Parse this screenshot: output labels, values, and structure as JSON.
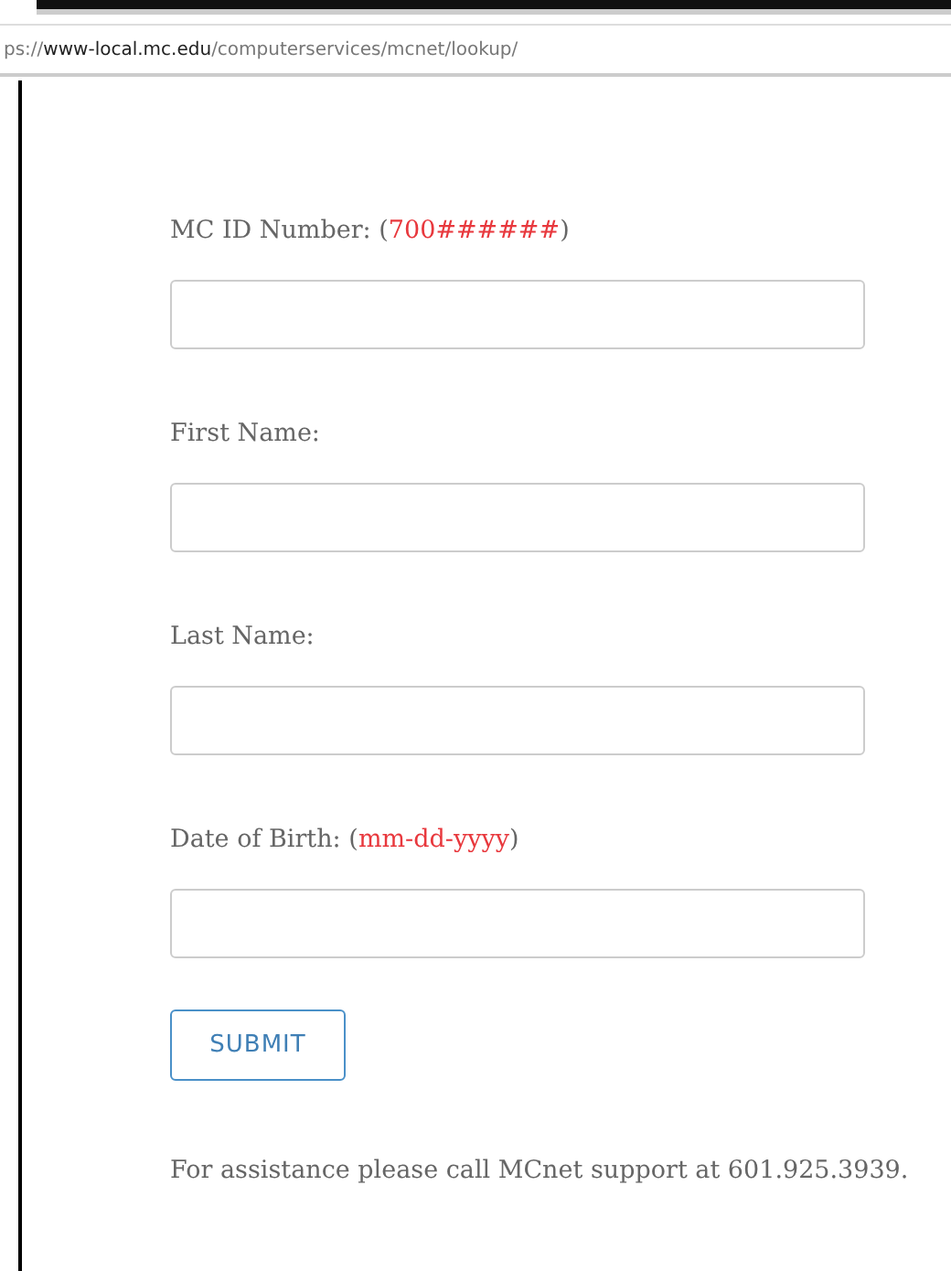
{
  "address_bar": {
    "url_parts": [
      {
        "text": "ps://",
        "kind": "dim"
      },
      {
        "text": "www-local.mc.edu",
        "kind": "host"
      },
      {
        "text": "/computerservices/mcnet/lookup/",
        "kind": "dim"
      }
    ]
  },
  "form": {
    "fields": [
      {
        "label": "MC ID Number:",
        "hint": "(700######)"
      },
      {
        "label": "First Name:"
      },
      {
        "label": "Last Name:"
      },
      {
        "label": "Date of Birth:",
        "hint": "(mm-dd-yyyy)"
      }
    ],
    "submit": "SUBMIT",
    "footer": "For assistance please call MCnet support at 601.925.3939."
  }
}
